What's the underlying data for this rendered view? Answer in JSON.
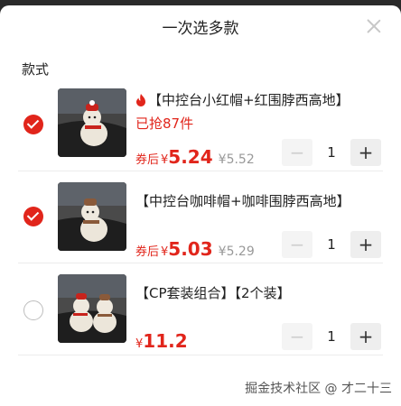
{
  "header": {
    "title": "一次选多款"
  },
  "section_label": "款式",
  "items": [
    {
      "name": "【中控台小红帽+红围脖西高地】",
      "sold": "已抢87件",
      "price_tag": "券后",
      "currency": "¥",
      "price": "5.24",
      "original_price": "¥5.52",
      "quantity": "1",
      "selected": true,
      "hot": true
    },
    {
      "name": "【中控台咖啡帽+咖啡围脖西高地】",
      "sold": "",
      "price_tag": "券后",
      "currency": "¥",
      "price": "5.03",
      "original_price": "¥5.29",
      "quantity": "1",
      "selected": true,
      "hot": false
    },
    {
      "name": "【CP套装组合】【2个装】",
      "sold": "",
      "price_tag": "",
      "currency": "¥",
      "price": "11.2",
      "original_price": "",
      "quantity": "1",
      "selected": false,
      "hot": false
    }
  ],
  "stepper": {
    "minus": "−",
    "plus": "+"
  },
  "watermark": "掘金技术社区 @ 才二十三",
  "colors": {
    "accent": "#e1251b"
  }
}
